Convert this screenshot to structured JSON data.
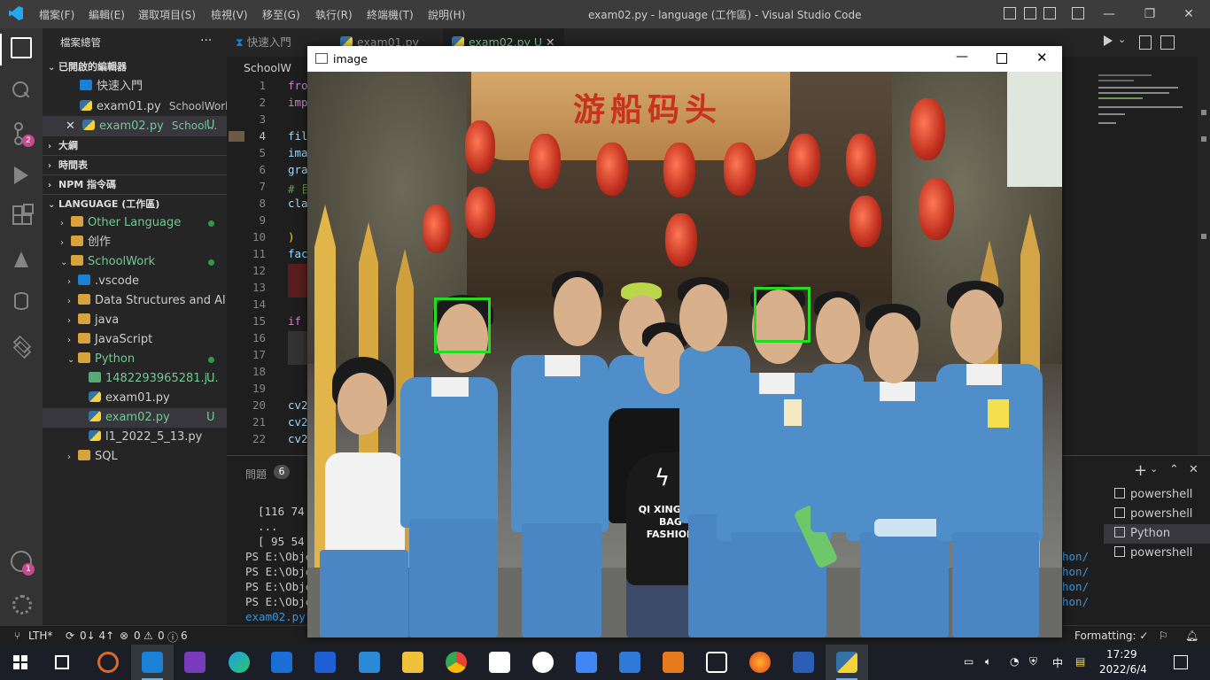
{
  "window": {
    "title": "exam02.py - language (工作區) - Visual Studio Code"
  },
  "menu": [
    "檔案(F)",
    "編輯(E)",
    "選取項目(S)",
    "檢視(V)",
    "移至(G)",
    "執行(R)",
    "終端機(T)",
    "說明(H)"
  ],
  "sidebar": {
    "title": "檔案總管",
    "more": "···",
    "open_editors_header": "已開啟的編輯器",
    "open_editors": [
      {
        "name": "快速入門",
        "desc": "",
        "status": ""
      },
      {
        "name": "exam01.py",
        "desc": "SchoolWork ...",
        "status": ""
      },
      {
        "name": "exam02.py",
        "desc": "School...",
        "status": "U"
      }
    ],
    "outline": "大綱",
    "timeline": "時間表",
    "npm": "NPM 指令碼",
    "workspace_header": "LANGUAGE (工作區)",
    "tree": [
      {
        "name": "Other Language",
        "status": "dot"
      },
      {
        "name": "创作",
        "status": ""
      },
      {
        "name": "SchoolWork",
        "status": "dot"
      },
      {
        "name": ".vscode",
        "status": ""
      },
      {
        "name": "Data Structures and Al...",
        "status": ""
      },
      {
        "name": "java",
        "status": ""
      },
      {
        "name": "JavaScript",
        "status": ""
      },
      {
        "name": "Python",
        "status": "dot"
      },
      {
        "name": "1482293965281.j...",
        "status": "U"
      },
      {
        "name": "exam01.py",
        "status": ""
      },
      {
        "name": "exam02.py",
        "status": "U"
      },
      {
        "name": "l1_2022_5_13.py",
        "status": ""
      },
      {
        "name": "SQL",
        "status": ""
      }
    ],
    "activity_badges": {
      "scm": "2",
      "accounts": "1"
    }
  },
  "tabs": [
    {
      "label": "快速入門"
    },
    {
      "label": "exam01.py"
    },
    {
      "label": "exam02.py",
      "status": "U"
    }
  ],
  "breadcrumb": "SchoolW",
  "editor": {
    "line_numbers": [
      "1",
      "2",
      "3",
      "4",
      "5",
      "6",
      "7",
      "8",
      "9",
      "10",
      "11",
      "12",
      "13",
      "14",
      "15",
      "16",
      "17",
      "18",
      "19",
      "20",
      "21",
      "22"
    ],
    "code": {
      "l1": "fro",
      "l2": "imp",
      "l4": "fil",
      "l5": "ima",
      "l6": "gra",
      "l7": "# 目",
      "l8": "cla",
      "l10": ")",
      "l11": "fac",
      "l15": "if",
      "l20": "cv2",
      "l21": "cv2",
      "l22": "cv2"
    }
  },
  "panel": {
    "problems_label": "問題",
    "problems_count": "6",
    "terminal_lines": [
      "[116  74",
      " ...",
      " [ 95  54",
      "PS E:\\Obje",
      "PS E:\\Obje",
      "PS E:\\Obje",
      "PS E:\\Obje",
      "exam02.py\""
    ],
    "terminal_right": [
      "hon/",
      "hon/",
      "hon/",
      "hon/"
    ],
    "terminals": [
      "powershell",
      "powershell",
      "Python",
      "powershell"
    ]
  },
  "statusbar": {
    "branch": "LTH*",
    "sync": "0↓ 4↑",
    "errors": "0",
    "warnings": "0",
    "info": "6",
    "formatting": "Formatting: ✓"
  },
  "image_window": {
    "title": "image",
    "sign_text": "游船码头",
    "bag_text": "QI XING CAI BAG FASHION"
  },
  "taskbar": {
    "time": "17:29",
    "date": "2022/6/4",
    "ime": "中"
  },
  "colors": {
    "accent": "#007acc",
    "face_box": "#22dd22",
    "git_added": "#73c991"
  }
}
